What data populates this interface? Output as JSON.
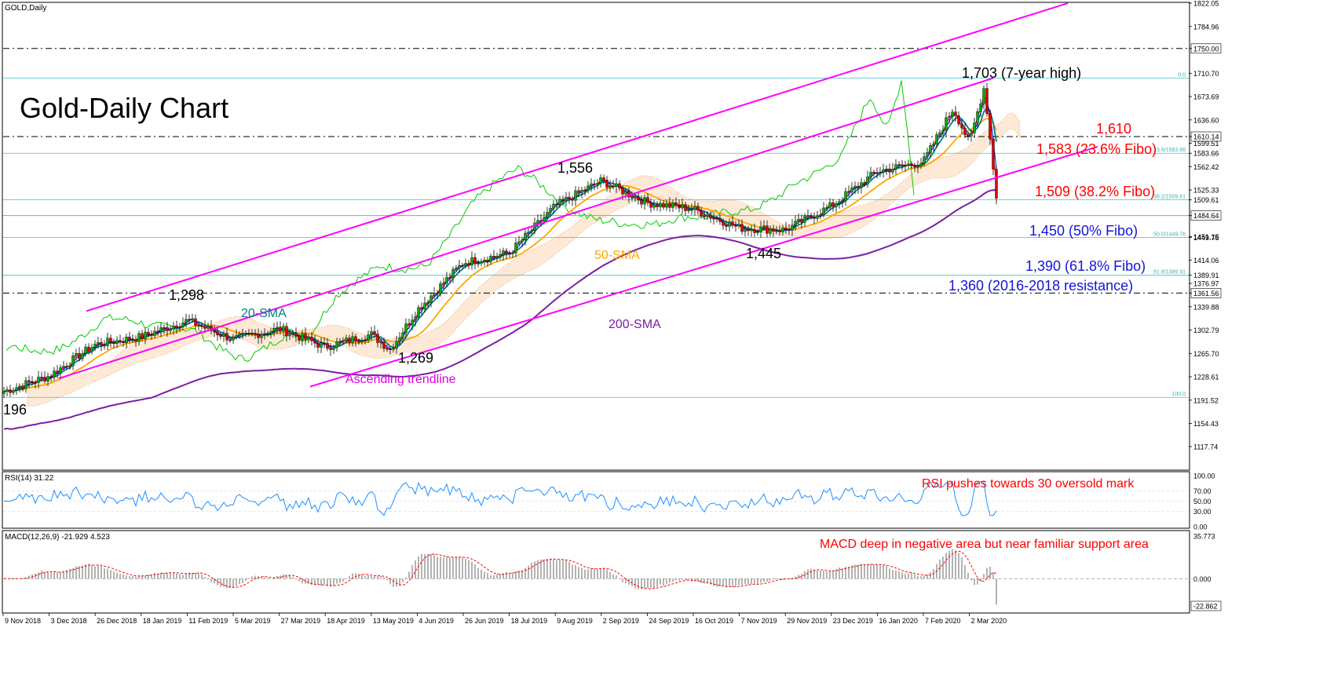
{
  "header": {
    "symbol": "GOLD,Daily"
  },
  "main": {
    "title": "Gold-Daily Chart"
  },
  "colors": {
    "sma20": "#008080",
    "sma50": "#ffa500",
    "sma200": "#7b1fa2",
    "trend": "#ff00ff",
    "fibo": "#40c0c0",
    "ichimoku": "#f4a460",
    "chikou": "#00cc00",
    "tenkan": "#ff0000",
    "kijun": "#0000ff",
    "rsi": "#1e90ff",
    "macd_hist": "#a0a0a0",
    "macd_signal": "#ff0000"
  },
  "chart_data": [
    {
      "type": "line",
      "title": "Gold-Daily Chart",
      "ylim": [
        1117.74,
        1822.05
      ],
      "price_axis": {
        "ticks": [
          "1822.05",
          "1784.96",
          "1750.00",
          "1710.70",
          "1673.69",
          "1636.60",
          "1610.14",
          "1599.51",
          "1583.66",
          "1562.42",
          "1525.33",
          "1509.61",
          "1484.64",
          "1449.76",
          "1451.15",
          "1414.06",
          "1389.91",
          "1376.97",
          "1361.56",
          "1339.88",
          "1302.79",
          "1265.70",
          "1228.61",
          "1191.52",
          "1154.43",
          "1117.74"
        ]
      },
      "x_labels": [
        "9 Nov 2018",
        "3 Dec 2018",
        "26 Dec 2018",
        "18 Jan 2019",
        "11 Feb 2019",
        "5 Mar 2019",
        "27 Mar 2019",
        "18 Apr 2019",
        "13 May 2019",
        "4 Jun 2019",
        "26 Jun 2019",
        "18 Jul 2019",
        "9 Aug 2019",
        "2 Sep 2019",
        "24 Sep 2019",
        "16 Oct 2019",
        "7 Nov 2019",
        "29 Nov 2019",
        "23 Dec 2019",
        "16 Jan 2020",
        "7 Feb 2020",
        "2 Mar 2020"
      ],
      "price_path": [
        [
          "9 Nov 2018",
          1205
        ],
        [
          "3 Dec 2018",
          1230
        ],
        [
          "26 Dec 2018",
          1280
        ],
        [
          "18 Jan 2019",
          1292
        ],
        [
          "11 Feb 2019",
          1318
        ],
        [
          "5 Mar 2019",
          1288
        ],
        [
          "27 Mar 2019",
          1305
        ],
        [
          "18 Apr 2019",
          1276
        ],
        [
          "13 May 2019",
          1296
        ],
        [
          "22 May 2019",
          1272
        ],
        [
          "4 Jun 2019",
          1335
        ],
        [
          "26 Jun 2019",
          1410
        ],
        [
          "18 Jul 2019",
          1425
        ],
        [
          "9 Aug 2019",
          1500
        ],
        [
          "2 Sep 2019",
          1540
        ],
        [
          "24 Sep 2019",
          1505
        ],
        [
          "16 Oct 2019",
          1495
        ],
        [
          "7 Nov 2019",
          1465
        ],
        [
          "29 Nov 2019",
          1462
        ],
        [
          "23 Dec 2019",
          1500
        ],
        [
          "16 Jan 2020",
          1555
        ],
        [
          "7 Feb 2020",
          1570
        ],
        [
          "24 Feb 2020",
          1655
        ],
        [
          "2 Mar 2020",
          1600
        ],
        [
          "9 Mar 2020",
          1690
        ],
        [
          "16 Mar 2020",
          1475
        ]
      ],
      "series": [
        {
          "name": "20-SMA",
          "color": "#008080"
        },
        {
          "name": "50-SMA",
          "color": "#ffa500"
        },
        {
          "name": "200-SMA",
          "color": "#7b1fa2"
        },
        {
          "name": "Ascending trendline",
          "color": "#ff00ff"
        }
      ],
      "levels": [
        {
          "value": 1750.0,
          "axis_label": "1750.00",
          "style": "dashdot"
        },
        {
          "value": 1610.14,
          "axis_label": "1610.14",
          "style": "dashdot"
        },
        {
          "value": 1361.56,
          "axis_label": "1361.56",
          "style": "dashdot"
        },
        {
          "value": 1484.64,
          "axis_label": "1484.64",
          "style": "solid"
        }
      ],
      "fibo_levels": [
        {
          "label": "0.0",
          "value": 1703.0
        },
        {
          "label": "23.6/1583.66",
          "value": 1583.66
        },
        {
          "label": "38.2/1509.61",
          "value": 1509.61
        },
        {
          "label": "50.0/1449.76",
          "value": 1449.76
        },
        {
          "label": "61.8/1389.91",
          "value": 1389.91
        },
        {
          "label": "100.0",
          "value": 1196.0
        }
      ],
      "annotations": {
        "high": "1,703 (7-year high)",
        "r1610": "1,610",
        "f236": "1,583 (23.6% Fibo)",
        "f382": "1,509 (38.2% Fibo)",
        "f50": "1,450 (50% Fibo)",
        "f618": "1,390 (61.8% Fibo)",
        "r1360": "1,360 (2016-2018 resistance)",
        "p1556": "1,556",
        "p1445": "1,445",
        "p1298": "1,298",
        "p1269": "1,269",
        "p196": "196",
        "sma20": "20-SMA",
        "sma50": "50-SMA",
        "sma200": "200-SMA",
        "trend": "Ascending trendline"
      }
    },
    {
      "type": "line",
      "title": "RSI(14) 31.22",
      "ylim": [
        0,
        100
      ],
      "ticks": [
        "100.00",
        "70.00",
        "50.00",
        "30.00",
        "0.00"
      ],
      "last_value": 31.22,
      "annotation": "RSI pushes towards 30 oversold mark"
    },
    {
      "type": "bar",
      "title": "MACD(12,26,9) -21.929 4.523",
      "ylim": [
        -22.862,
        35.773
      ],
      "ticks": [
        "35.773",
        "0.000",
        "-22.862"
      ],
      "macd": -21.929,
      "signal": 4.523,
      "annotation": "MACD deep in negative area but near familiar support area"
    }
  ]
}
